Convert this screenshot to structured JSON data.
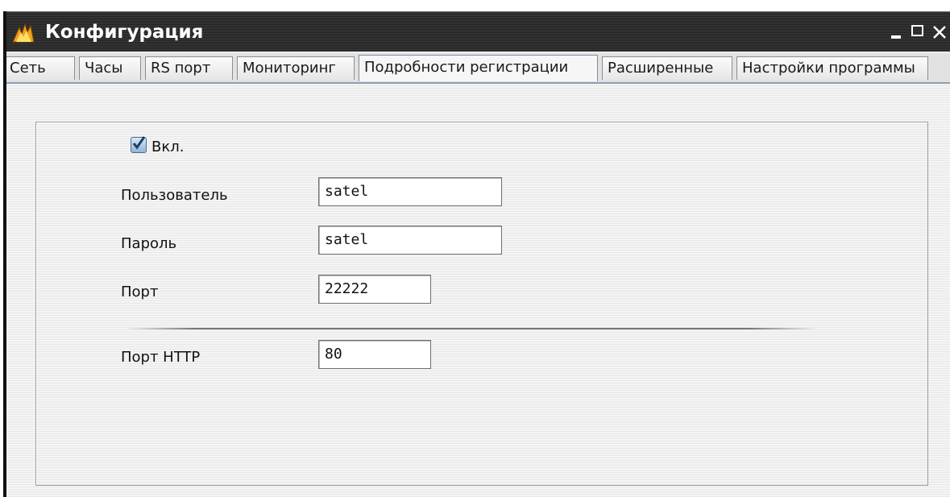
{
  "window": {
    "title": "Конфигурация",
    "icon": "app-icon"
  },
  "tabs": [
    {
      "label": "Сеть",
      "active": false
    },
    {
      "label": "Часы",
      "active": false
    },
    {
      "label": "RS порт",
      "active": false
    },
    {
      "label": "Мониторинг",
      "active": false
    },
    {
      "label": "Подробности регистрации",
      "active": true
    },
    {
      "label": "Расширенные",
      "active": false
    },
    {
      "label": "Настройки программы",
      "active": false
    }
  ],
  "form": {
    "enabled_label": "Вкл.",
    "enabled_checked": true,
    "user_label": "Пользователь",
    "user_value": "satel",
    "password_label": "Пароль",
    "password_value": "satel",
    "port_label": "Порт",
    "port_value": "22222",
    "http_port_label": "Порт HTTP",
    "http_port_value": "80"
  },
  "colors": {
    "titlebar": "#1f1f1f",
    "tab_active_border": "#7b8fa6",
    "checkbox_fill": "#8fb4d8"
  }
}
